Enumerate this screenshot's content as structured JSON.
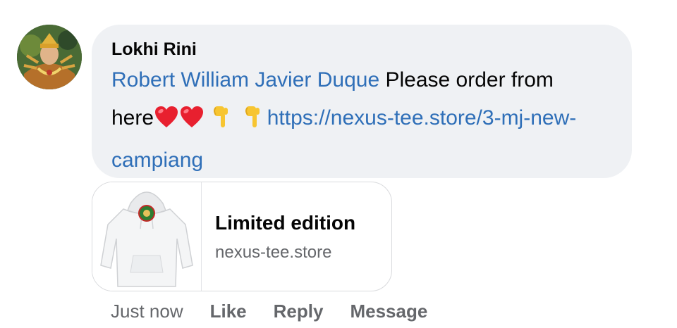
{
  "comment": {
    "author": "Lokhi Rini",
    "mention": "Robert William Javier Duque",
    "text_before_break": " Please order from",
    "text_here": "here",
    "emojis": [
      "red-heart",
      "red-heart",
      "backhand-index-pointing-down",
      "backhand-index-pointing-down"
    ],
    "link_text": "https://nexus-tee.store/3-mj-new-campiang"
  },
  "link_preview": {
    "title": "Limited edition",
    "domain": "nexus-tee.store"
  },
  "actions": {
    "timestamp": "Just now",
    "like": "Like",
    "reply": "Reply",
    "message": "Message"
  },
  "colors": {
    "bubble_bg": "#eff1f4",
    "link": "#2f6fb8",
    "secondary_text": "#65676b"
  }
}
